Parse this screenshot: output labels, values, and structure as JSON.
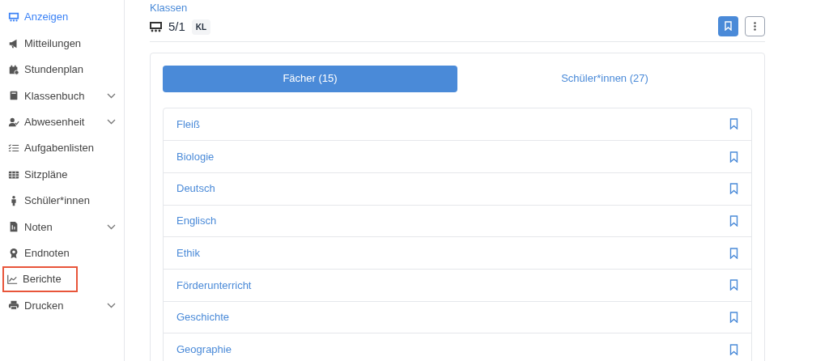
{
  "sidebar": {
    "items": [
      {
        "label": "Anzeigen",
        "selected": true,
        "expandable": false,
        "highlighted": false
      },
      {
        "label": "Mitteilungen",
        "selected": false,
        "expandable": false,
        "highlighted": false
      },
      {
        "label": "Stundenplan",
        "selected": false,
        "expandable": false,
        "highlighted": false
      },
      {
        "label": "Klassenbuch",
        "selected": false,
        "expandable": true,
        "highlighted": false
      },
      {
        "label": "Abwesenheit",
        "selected": false,
        "expandable": true,
        "highlighted": false
      },
      {
        "label": "Aufgabenlisten",
        "selected": false,
        "expandable": false,
        "highlighted": false
      },
      {
        "label": "Sitzpläne",
        "selected": false,
        "expandable": false,
        "highlighted": false
      },
      {
        "label": "Schüler*innen",
        "selected": false,
        "expandable": false,
        "highlighted": false
      },
      {
        "label": "Noten",
        "selected": false,
        "expandable": true,
        "highlighted": false
      },
      {
        "label": "Endnoten",
        "selected": false,
        "expandable": false,
        "highlighted": false
      },
      {
        "label": "Berichte",
        "selected": false,
        "expandable": false,
        "highlighted": true
      },
      {
        "label": "Drucken",
        "selected": false,
        "expandable": true,
        "highlighted": false
      }
    ]
  },
  "header": {
    "breadcrumb": "Klassen",
    "class_name": "5/1",
    "badge": "KL",
    "bookmarked": true
  },
  "tabs": [
    {
      "label": "Fächer (15)",
      "selected": true
    },
    {
      "label": "Schüler*innen (27)",
      "selected": false
    }
  ],
  "subjects": [
    {
      "name": "Fleiß",
      "bookmarked": false
    },
    {
      "name": "Biologie",
      "bookmarked": false
    },
    {
      "name": "Deutsch",
      "bookmarked": false
    },
    {
      "name": "Englisch",
      "bookmarked": false
    },
    {
      "name": "Ethik",
      "bookmarked": false
    },
    {
      "name": "Förderunterricht",
      "bookmarked": false
    },
    {
      "name": "Geschichte",
      "bookmarked": false
    },
    {
      "name": "Geographie",
      "bookmarked": false
    }
  ]
}
